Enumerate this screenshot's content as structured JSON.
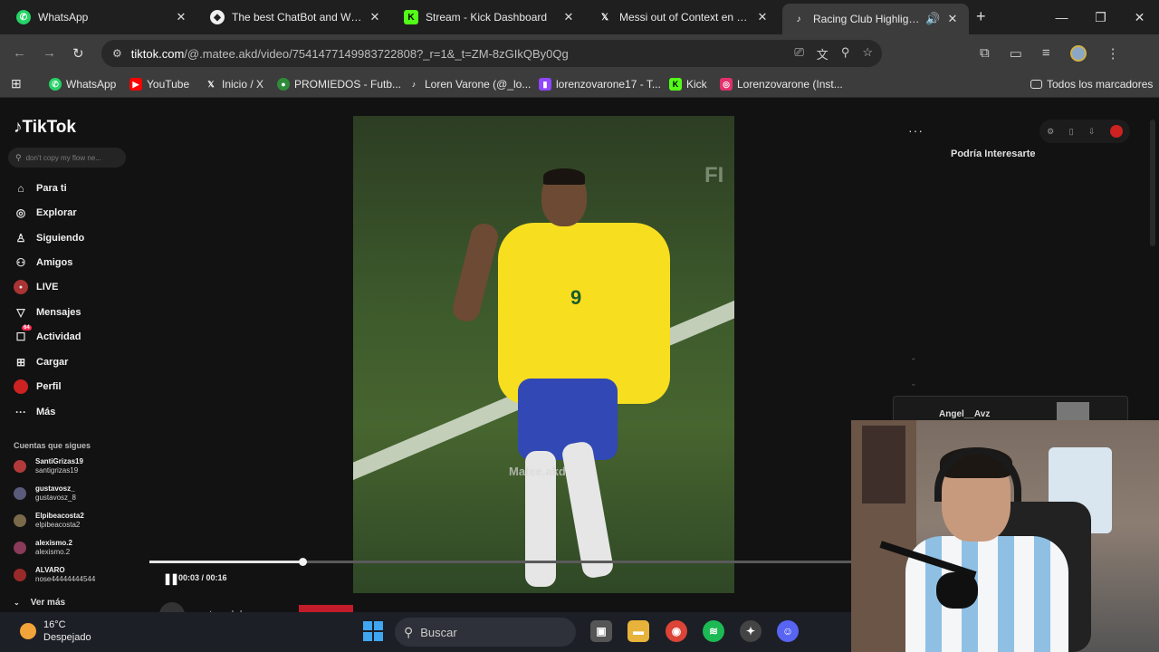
{
  "tabs": [
    {
      "title": "WhatsApp",
      "icon": "whatsapp-icon",
      "color": "#25d366"
    },
    {
      "title": "The best ChatBot and Widget",
      "icon": "botrix-icon",
      "color": "#f0f0f0"
    },
    {
      "title": "Stream - Kick Dashboard",
      "icon": "kick-icon",
      "color": "#53fc18"
    },
    {
      "title": "Messi out of Context en X: \"I",
      "icon": "x-icon",
      "color": "#ffffff"
    },
    {
      "title": "Racing Club Highlights: M",
      "icon": "tiktok-icon",
      "color": "#ffffff"
    }
  ],
  "address": {
    "domain": "tiktok.com",
    "path": "/@.matee.akd/video/7541477149983722808?_r=1&_t=ZM-8zGIkQBy0Qg"
  },
  "bookmarks": [
    {
      "label": "WhatsApp",
      "icon": "whatsapp-icon",
      "color": "#25d366"
    },
    {
      "label": "YouTube",
      "icon": "youtube-icon",
      "color": "#ff0000"
    },
    {
      "label": "Inicio / X",
      "icon": "x-icon",
      "color": "#ffffff"
    },
    {
      "label": "PROMIEDOS - Futb...",
      "icon": "promiedos-icon",
      "color": "#2e8b3a"
    },
    {
      "label": "Loren Varone (@_lo...",
      "icon": "tiktok-icon",
      "color": "#ffffff"
    },
    {
      "label": "lorenzovarone17 - T...",
      "icon": "twitch-icon",
      "color": "#9146ff"
    },
    {
      "label": "Kick",
      "icon": "kick-icon",
      "color": "#53fc18"
    },
    {
      "label": "Lorenzovarone (Inst...",
      "icon": "instagram-icon",
      "color": "#e1306c"
    }
  ],
  "all_bookmarks": "Todos los marcadores",
  "tiktok": {
    "logo": "TikTok",
    "search_placeholder": "don't copy my flow ne...",
    "nav": [
      {
        "label": "Para ti",
        "icon": "home-icon"
      },
      {
        "label": "Explorar",
        "icon": "compass-icon"
      },
      {
        "label": "Siguiendo",
        "icon": "following-icon"
      },
      {
        "label": "Amigos",
        "icon": "friends-icon"
      },
      {
        "label": "LIVE",
        "icon": "live-icon"
      },
      {
        "label": "Mensajes",
        "icon": "messages-icon"
      },
      {
        "label": "Actividad",
        "icon": "activity-icon",
        "badge": "64"
      },
      {
        "label": "Cargar",
        "icon": "upload-icon"
      },
      {
        "label": "Perfil",
        "icon": "profile-icon"
      },
      {
        "label": "Más",
        "icon": "more-icon"
      }
    ],
    "following_title": "Cuentas que sigues",
    "following": [
      {
        "name": "SantiGrizas19",
        "handle": "santigrizas19",
        "color": "#b23a3a"
      },
      {
        "name": "gustavosz_",
        "handle": "gustavosz_8",
        "color": "#5a5a7a"
      },
      {
        "name": "Elpibeacosta2",
        "handle": "elpibeacosta2",
        "color": "#7a6a4a"
      },
      {
        "name": "alexismo.2",
        "handle": "alexismo.2",
        "color": "#8a3a5a"
      },
      {
        "name": "ALVARO",
        "handle": "nose44444444544",
        "color": "#9a2a2a"
      }
    ],
    "see_more": "Ver más",
    "video_watermark": "Matee.akd",
    "video_overlay_text": "FI",
    "jersey_number": "9",
    "time": "00:03 / 00:16",
    "progress": 0.218,
    "author": "matee.akd",
    "recommend_title": "Podría Interesarte",
    "chat_user": "Angel__Avz"
  },
  "taskbar": {
    "temp": "16°C",
    "weather": "Despejado",
    "search": "Buscar"
  }
}
